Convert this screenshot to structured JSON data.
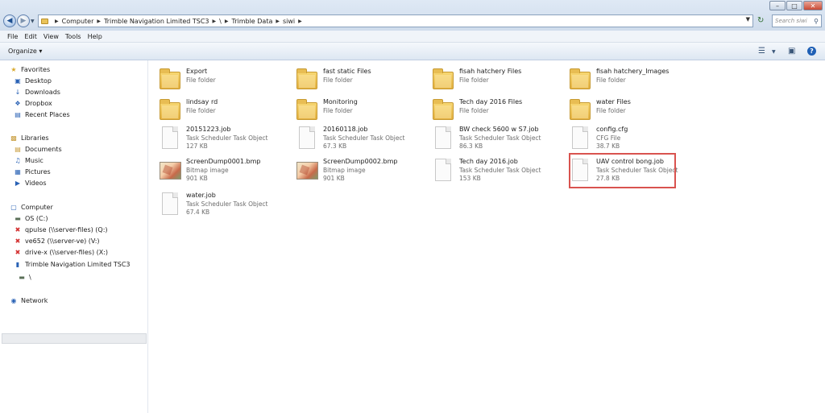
{
  "window": {
    "min_label": "–",
    "max_label": "□",
    "close_label": "✕"
  },
  "address": {
    "crumbs": [
      "Computer",
      "Trimble Navigation Limited TSC3",
      "\\",
      "Trimble Data",
      "siwi"
    ],
    "search_placeholder": "Search siwi"
  },
  "menu": [
    "File",
    "Edit",
    "View",
    "Tools",
    "Help"
  ],
  "toolbar": {
    "organize_label": "Organize ▾",
    "help_label": "?"
  },
  "nav": {
    "favorites": "Favorites",
    "desktop": "Desktop",
    "downloads": "Downloads",
    "dropbox": "Dropbox",
    "recent": "Recent Places",
    "libraries": "Libraries",
    "documents": "Documents",
    "music": "Music",
    "pictures": "Pictures",
    "videos": "Videos",
    "computer": "Computer",
    "os": "OS (C:)",
    "qpulse": "qpulse (\\\\server-files) (Q:)",
    "ve652": "ve652 (\\\\server-ve) (V:)",
    "drivex": "drive-x (\\\\server-files) (X:)",
    "trimble": "Trimble Navigation Limited TSC3",
    "root": "\\",
    "network": "Network"
  },
  "files": {
    "f1": {
      "name": "Export",
      "type": "File folder"
    },
    "f2": {
      "name": "fast static Files",
      "type": "File folder"
    },
    "f3": {
      "name": "fisah hatchery Files",
      "type": "File folder"
    },
    "f4": {
      "name": "fisah hatchery_Images",
      "type": "File folder"
    },
    "f5": {
      "name": "lindsay rd",
      "type": "File folder"
    },
    "f6": {
      "name": "Monitoring",
      "type": "File folder"
    },
    "f7": {
      "name": "Tech day 2016 Files",
      "type": "File folder"
    },
    "f8": {
      "name": "water Files",
      "type": "File folder"
    },
    "f9": {
      "name": "20151223.job",
      "type": "Task Scheduler Task Object",
      "size": "127 KB"
    },
    "f10": {
      "name": "20160118.job",
      "type": "Task Scheduler Task Object",
      "size": "67.3 KB"
    },
    "f11": {
      "name": "BW check 5600 w S7.job",
      "type": "Task Scheduler Task Object",
      "size": "86.3 KB"
    },
    "f12": {
      "name": "config.cfg",
      "type": "CFG File",
      "size": "38.7 KB"
    },
    "f13": {
      "name": "ScreenDump0001.bmp",
      "type": "Bitmap image",
      "size": "901 KB"
    },
    "f14": {
      "name": "ScreenDump0002.bmp",
      "type": "Bitmap image",
      "size": "901 KB"
    },
    "f15": {
      "name": "Tech day 2016.job",
      "type": "Task Scheduler Task Object",
      "size": "153 KB"
    },
    "f16": {
      "name": "UAV control bong.job",
      "type": "Task Scheduler Task Object",
      "size": "27.8 KB"
    },
    "f17": {
      "name": "water.job",
      "type": "Task Scheduler Task Object",
      "size": "67.4 KB"
    }
  },
  "colors": {
    "highlight": "#d9534f",
    "accent": "#1e5fb5"
  }
}
